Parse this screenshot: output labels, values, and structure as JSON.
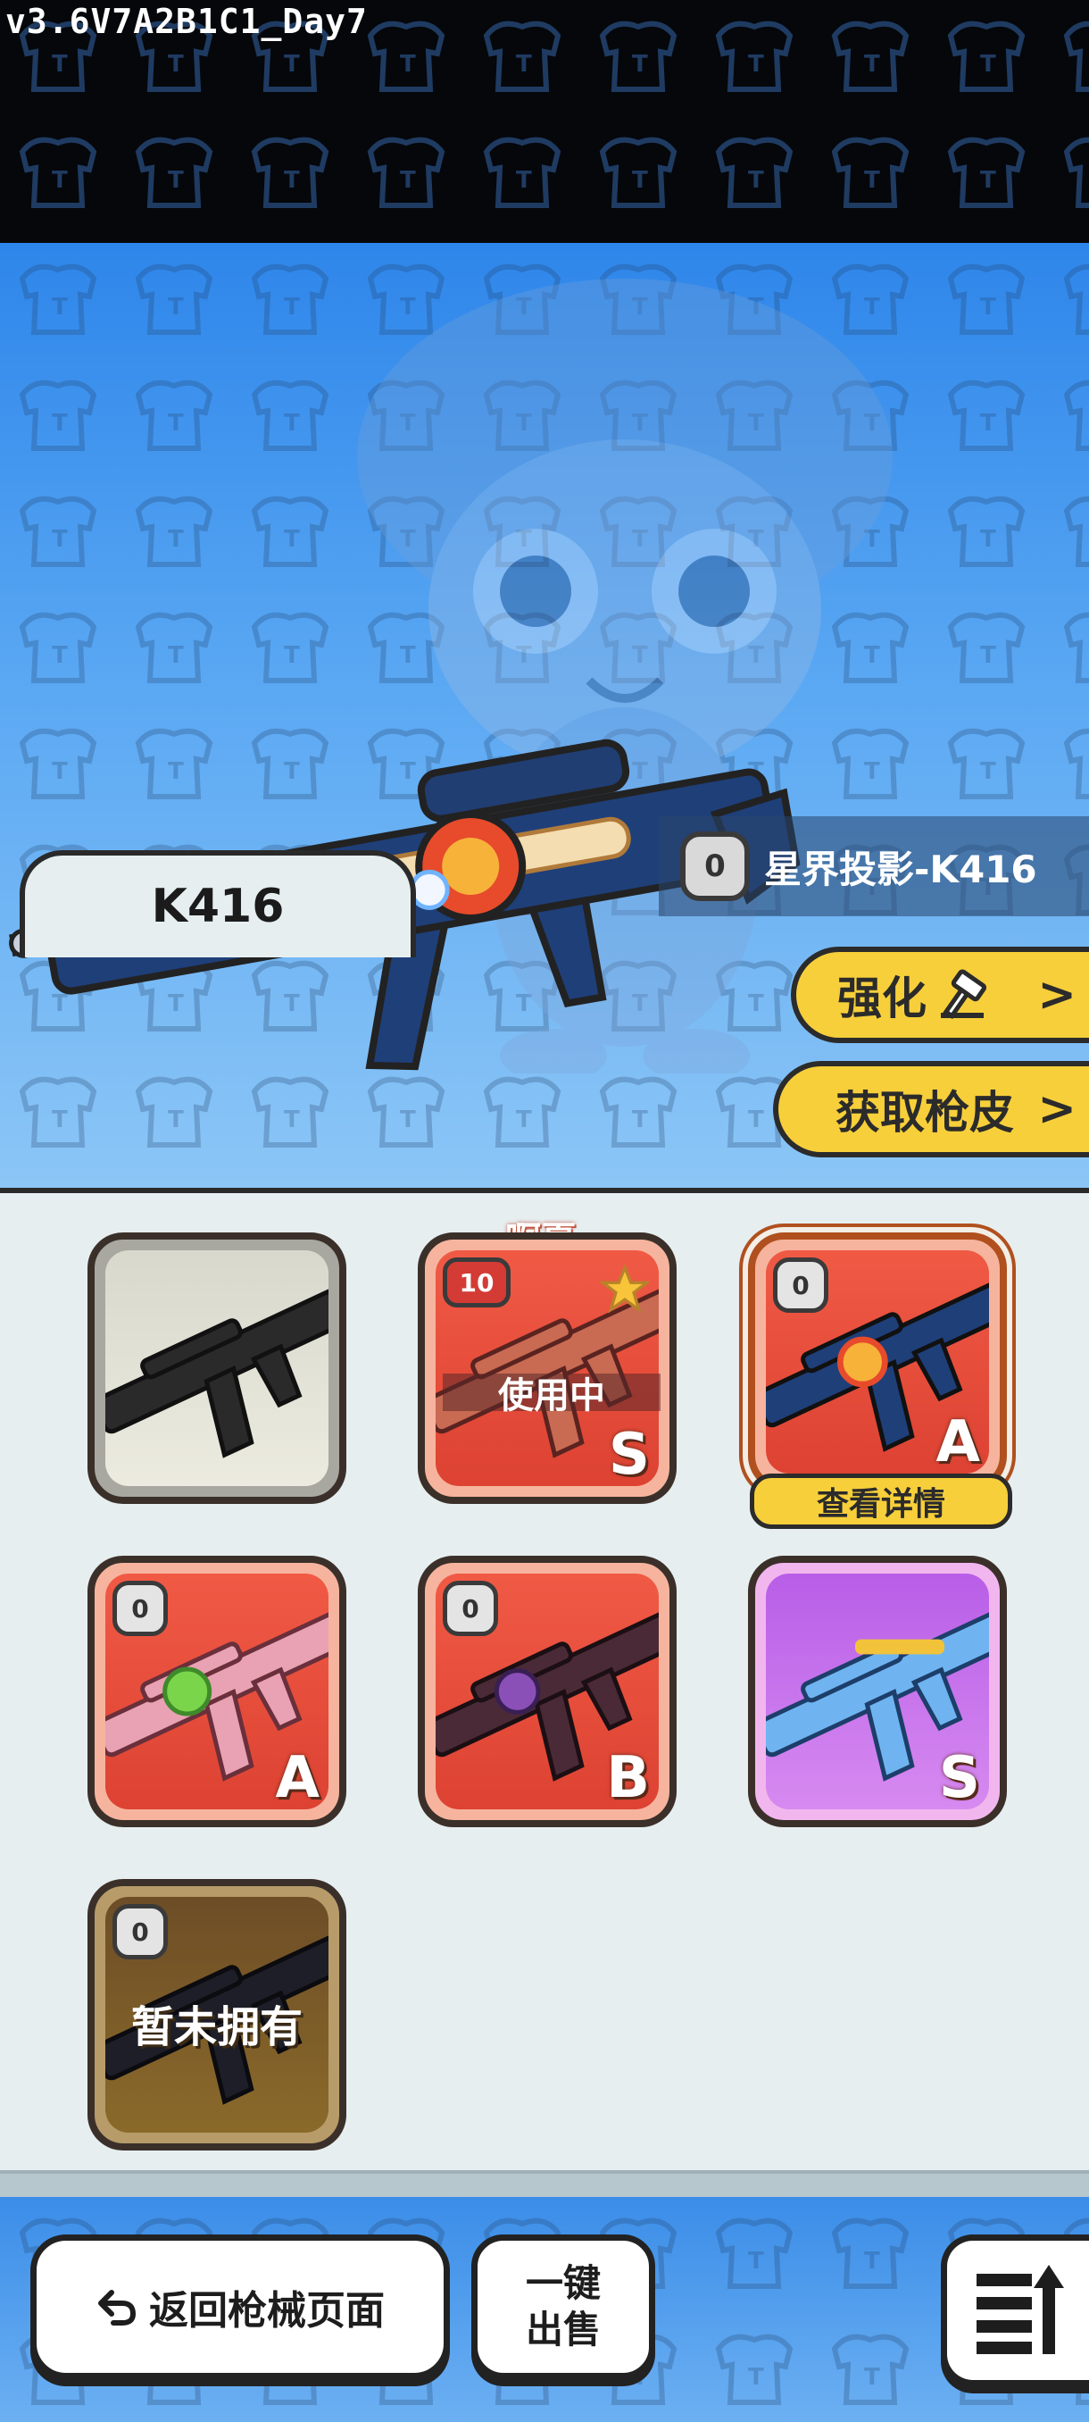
{
  "build": {
    "version": "v3.6V7A2B1C1_Day7"
  },
  "hero": {
    "skin_level": "0",
    "skin_name": "星界投影-K416",
    "upgrade_label": "强化",
    "get_skin_label": "获取枪皮",
    "chevron": ">"
  },
  "tab": {
    "label": "K416"
  },
  "cards": [
    {
      "id": "default",
      "style": "gray",
      "level": "",
      "rank": "",
      "state": "owned"
    },
    {
      "id": "ahxia",
      "style": "red",
      "level": "10",
      "rank": "S",
      "owner": "啊夏",
      "status": "使用中"
    },
    {
      "id": "astral",
      "style": "red",
      "level": "0",
      "rank": "A",
      "selected": true,
      "action": "查看详情"
    },
    {
      "id": "green",
      "style": "red",
      "level": "0",
      "rank": "A"
    },
    {
      "id": "purple-gem",
      "style": "red",
      "level": "0",
      "rank": "B"
    },
    {
      "id": "blue",
      "style": "purple",
      "level": "",
      "rank": "S"
    },
    {
      "id": "locked",
      "style": "brown",
      "level": "0",
      "rank": "",
      "status": "暂未拥有"
    }
  ],
  "card_text": {
    "c2_level": "10",
    "c2_rank": "S",
    "c2_owner": "啊夏",
    "c2_status": "使用中",
    "c3_level": "0",
    "c3_rank": "A",
    "c3_action": "查看详情",
    "c4_level": "0",
    "c4_rank": "A",
    "c5_level": "0",
    "c5_rank": "B",
    "c6_rank": "S",
    "c7_level": "0",
    "c7_status": "暂未拥有"
  },
  "footer": {
    "back_label": "返回枪械页面",
    "sell_line1": "一键",
    "sell_line2": "出售"
  },
  "colors": {
    "accent_yellow": "#f7cf3a",
    "hero_blue": "#2e86ea",
    "panel_bg": "#e6eef0",
    "rank_card_red": "#dd4232",
    "rank_card_purple": "#b85ee8"
  },
  "icons": [
    "hammer-icon",
    "chevron-right-icon",
    "back-arrow-icon",
    "sort-list-icon",
    "star-icon",
    "level-badge-icon"
  ]
}
